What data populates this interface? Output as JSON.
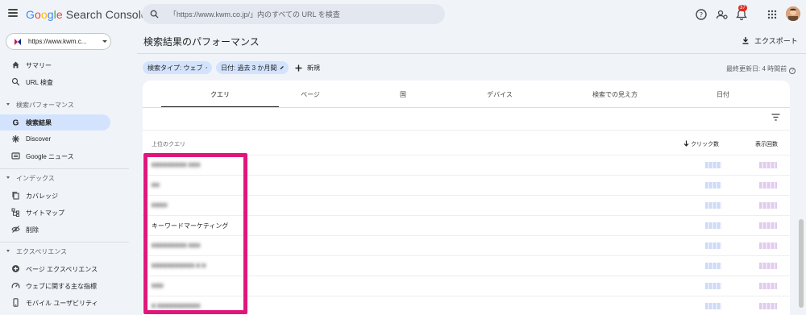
{
  "app": {
    "logo_google": [
      "G",
      "o",
      "o",
      "g",
      "l",
      "e"
    ],
    "product": "Search Console"
  },
  "search": {
    "placeholder": "「https://www.kwm.co.jp/」内のすべての URL を検査"
  },
  "notifications": {
    "count": "37"
  },
  "property": {
    "label": "https://www.kwm.c..."
  },
  "sidebar": {
    "items_top": [
      {
        "label": "サマリー",
        "icon": "home-icon"
      },
      {
        "label": "URL 検査",
        "icon": "search-icon"
      }
    ],
    "section_performance": "検索パフォーマンス",
    "items_performance": [
      {
        "label": "検索結果",
        "icon": "google-g-icon",
        "active": true
      },
      {
        "label": "Discover",
        "icon": "asterisk-icon"
      },
      {
        "label": "Google ニュース",
        "icon": "news-icon"
      }
    ],
    "section_index": "インデックス",
    "items_index": [
      {
        "label": "カバレッジ",
        "icon": "copy-icon"
      },
      {
        "label": "サイトマップ",
        "icon": "sitemap-icon"
      },
      {
        "label": "削除",
        "icon": "eye-off-icon"
      }
    ],
    "section_experience": "エクスペリエンス",
    "items_experience": [
      {
        "label": "ページ エクスペリエンス",
        "icon": "plus-circle-icon"
      },
      {
        "label": "ウェブに関する主な指標",
        "icon": "speed-icon"
      },
      {
        "label": "モバイル ユーザビリティ",
        "icon": "phone-icon"
      }
    ]
  },
  "main": {
    "title": "検索結果のパフォーマンス",
    "export_label": "エクスポート",
    "chips": [
      {
        "label": "検索タイプ: ウェブ"
      },
      {
        "label": "日付: 過去 3 か月間"
      }
    ],
    "new_label": "新規",
    "last_updated": "最終更新日: 4 時間前"
  },
  "tabs": [
    "クエリ",
    "ページ",
    "国",
    "デバイス",
    "検索での見え方",
    "日付"
  ],
  "table": {
    "col_query": "上位のクエリ",
    "col_clicks": "クリック数",
    "col_impressions": "表示回数",
    "rows": [
      {
        "query": "■■■■■■■■■ ■■■",
        "blurred": true
      },
      {
        "query": "■■",
        "blurred": true
      },
      {
        "query": "■■■■",
        "blurred": true
      },
      {
        "query": "キーワードマーケティング",
        "blurred": false
      },
      {
        "query": "■■■■■■■■■ ■■■",
        "blurred": true
      },
      {
        "query": "■■■■■■■■■■■ ■ ■",
        "blurred": true
      },
      {
        "query": "■■■",
        "blurred": true
      },
      {
        "query": "■ ■■■■■■■■■■■",
        "blurred": true
      }
    ]
  },
  "colors": {
    "accent": "#d3e3fd",
    "highlight": "#e0177b",
    "background": "#f0f4f9"
  }
}
